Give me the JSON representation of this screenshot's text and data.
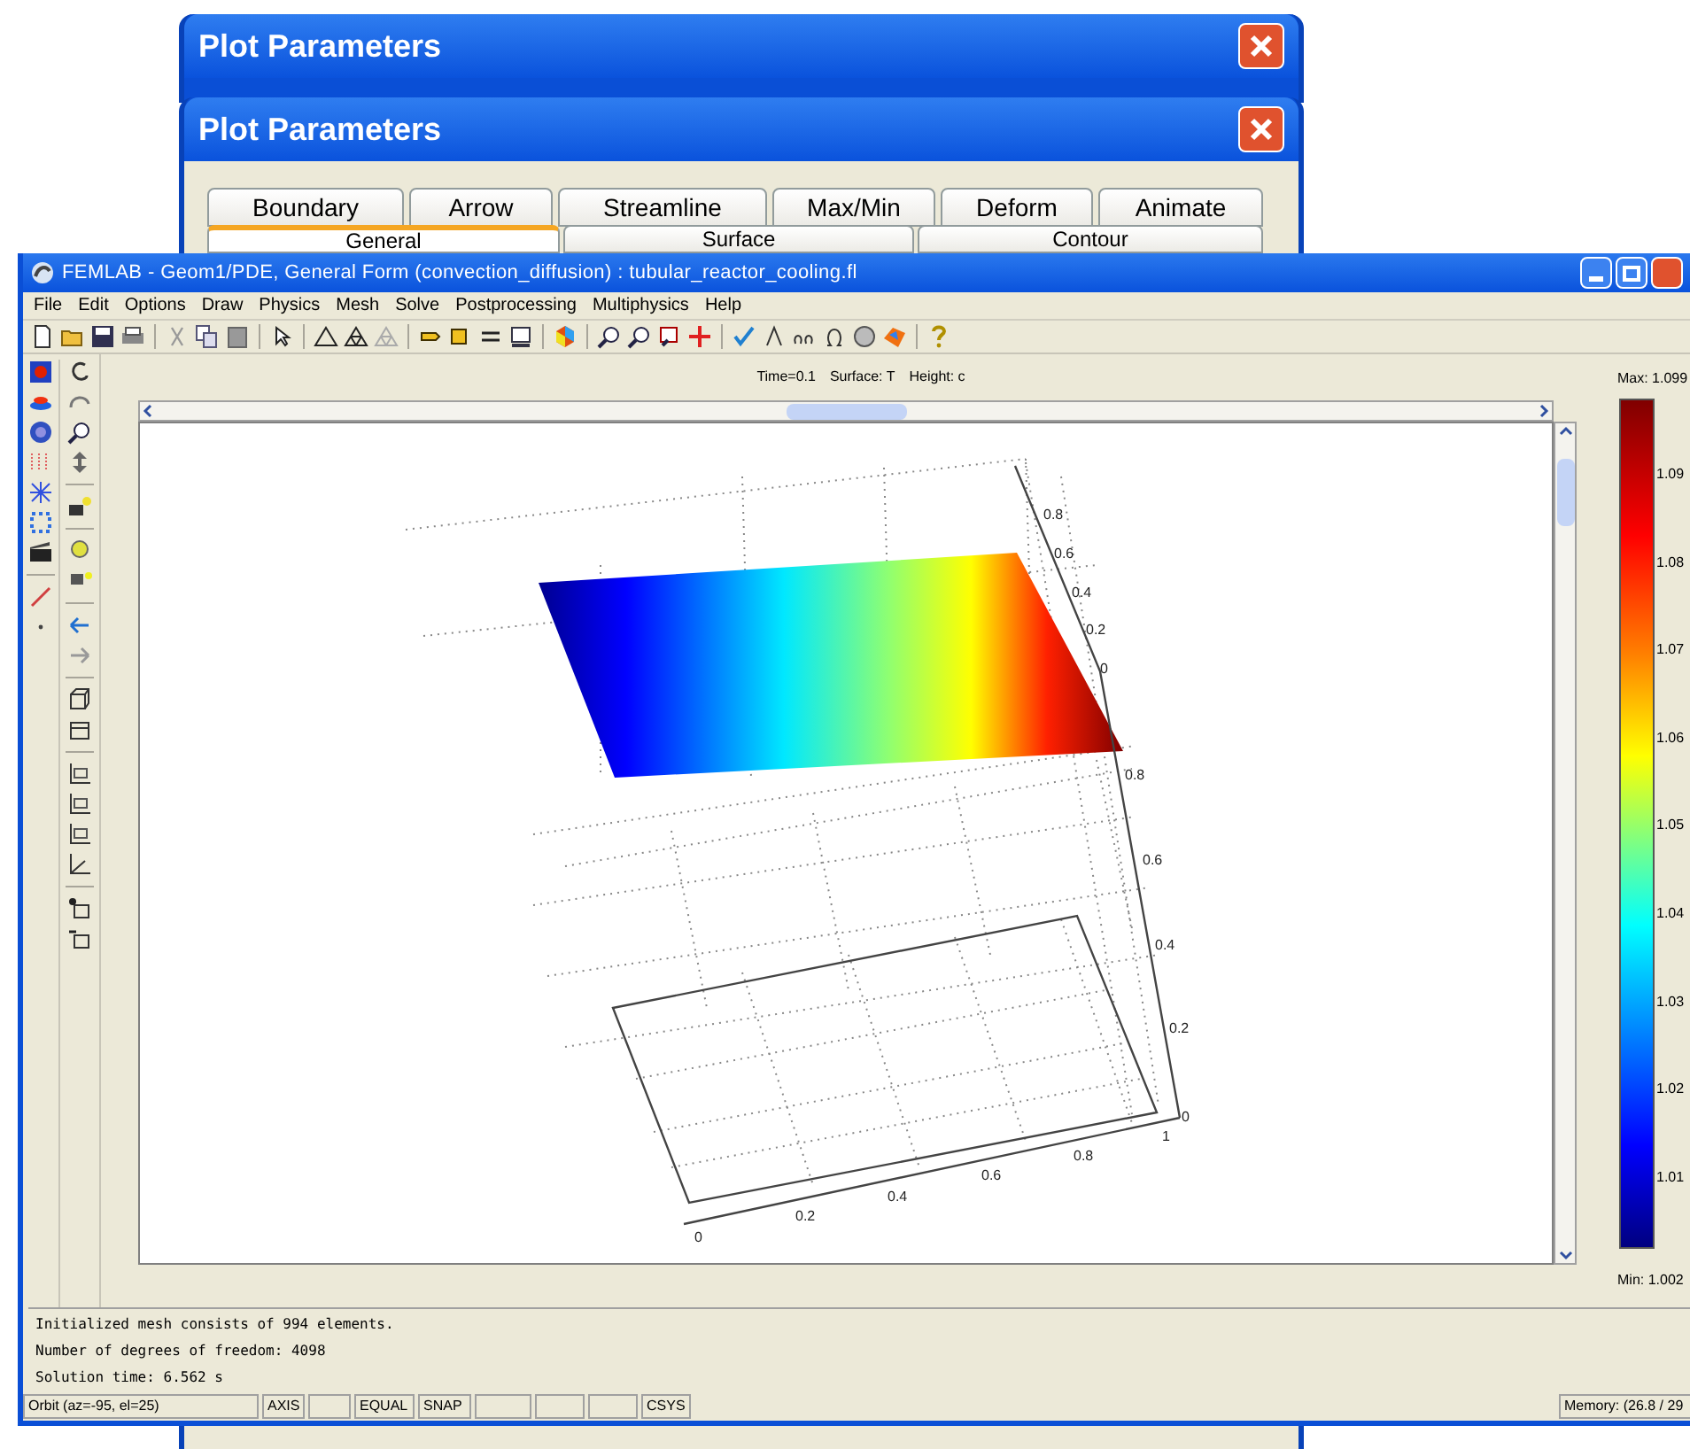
{
  "dialogs": [
    {
      "title": "Plot Parameters"
    },
    {
      "title": "Plot Parameters",
      "tab_rows": [
        [
          {
            "label": "Boundary",
            "selected": false
          },
          {
            "label": "Arrow",
            "selected": false
          },
          {
            "label": "Streamline",
            "selected": false
          },
          {
            "label": "Max/Min",
            "selected": false
          },
          {
            "label": "Deform",
            "selected": false
          },
          {
            "label": "Animate",
            "selected": false
          }
        ],
        [
          {
            "label": "General",
            "selected": true
          },
          {
            "label": "Surface",
            "selected": false
          },
          {
            "label": "Contour",
            "selected": false
          }
        ]
      ]
    }
  ],
  "main_window": {
    "title": "FEMLAB - Geom1/PDE, General Form (convection_diffusion) : tubular_reactor_cooling.fl",
    "menu": [
      "File",
      "Edit",
      "Options",
      "Draw",
      "Physics",
      "Mesh",
      "Solve",
      "Postprocessing",
      "Multiphysics",
      "Help"
    ],
    "plot_header": [
      "Time=0.1",
      "Surface: T",
      "Height: c"
    ],
    "plot": {
      "z_ticks_upper": [
        "0.8",
        "0.6",
        "0.4",
        "0.2",
        "0"
      ],
      "z_ticks_lower": [
        "0.8",
        "0.6",
        "0.4",
        "0.2",
        "0"
      ],
      "x_ticks": [
        "0",
        "0.2",
        "0.4",
        "0.6",
        "0.8",
        "1"
      ]
    },
    "colorbar": {
      "max": "Max: 1.099",
      "min": "Min: 1.002",
      "ticks": [
        "1.09",
        "1.08",
        "1.07",
        "1.06",
        "1.05",
        "1.04",
        "1.03",
        "1.02",
        "1.01"
      ]
    },
    "messages": [
      "Initialized mesh consists of 994 elements.",
      "Number of degrees of freedom: 4098",
      "Solution time: 6.562 s"
    ],
    "status_bar": {
      "mode": "Orbit (az=-95, el=25)",
      "toggles": [
        "AXIS",
        "EQUAL",
        "SNAP",
        "CSYS"
      ],
      "memory": "Memory: (26.8 / 29"
    }
  }
}
